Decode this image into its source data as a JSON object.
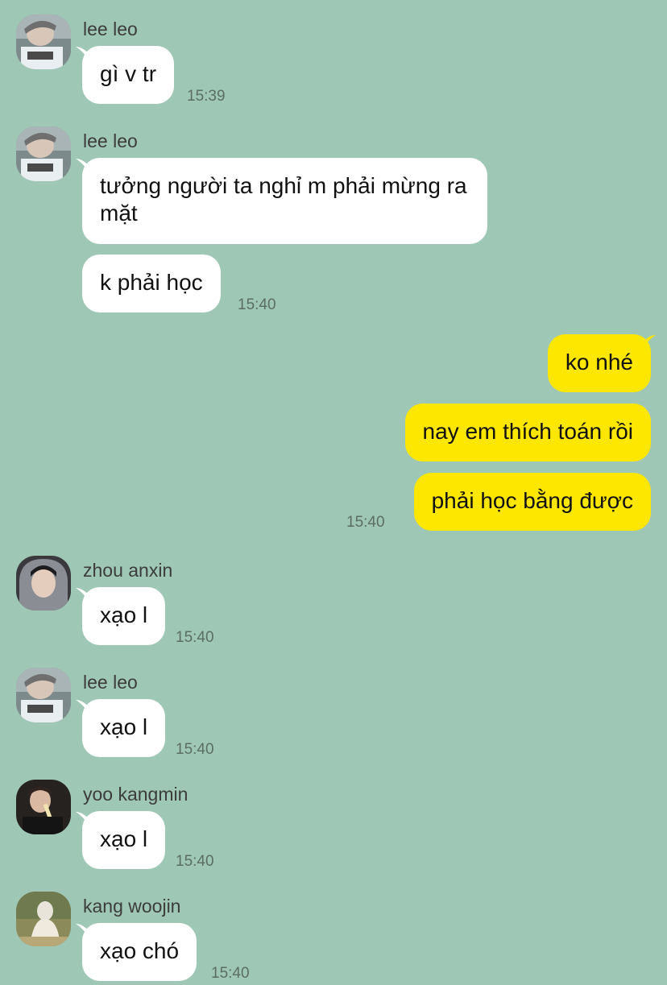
{
  "colors": {
    "background": "#9fc7b5",
    "incoming_bubble": "#ffffff",
    "outgoing_bubble": "#fde600",
    "timestamp": "#5b6e66"
  },
  "messages": [
    {
      "sender": "lee leo",
      "avatar": "lee-leo-avatar",
      "text": "gì v tr",
      "time": "15:39"
    },
    {
      "sender": "lee leo",
      "avatar": "lee-leo-avatar",
      "text": "tưởng người ta nghỉ m phải mừng ra mặt"
    },
    {
      "text": "k phải học",
      "time": "15:40"
    },
    {
      "outgoing": true,
      "text": "ko nhé"
    },
    {
      "outgoing": true,
      "text": "nay em thích toán rồi"
    },
    {
      "outgoing": true,
      "text": "phải học bằng được",
      "time": "15:40"
    },
    {
      "sender": "zhou anxin",
      "avatar": "zhou-anxin-avatar",
      "text": "xạo l",
      "time": "15:40"
    },
    {
      "sender": "lee leo",
      "avatar": "lee-leo-avatar",
      "text": "xạo l",
      "time": "15:40"
    },
    {
      "sender": "yoo kangmin",
      "avatar": "yoo-kangmin-avatar",
      "text": "xạo l",
      "time": "15:40"
    },
    {
      "sender": "kang woojin",
      "avatar": "kang-woojin-avatar",
      "text": "xạo chó",
      "time": "15:40"
    }
  ]
}
